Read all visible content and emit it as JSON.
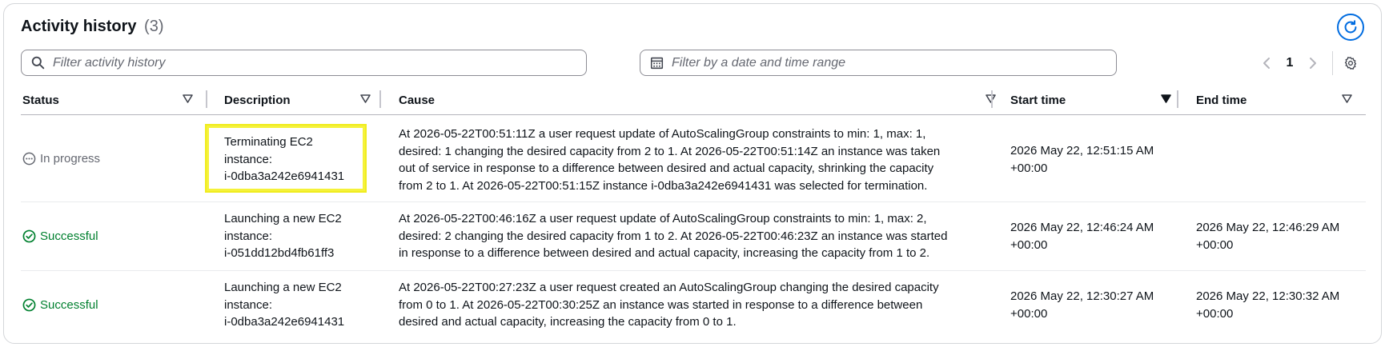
{
  "header": {
    "title": "Activity history",
    "count": "(3)"
  },
  "filters": {
    "search_placeholder": "Filter activity history",
    "date_placeholder": "Filter by a date and time range"
  },
  "pagination": {
    "current_page": "1"
  },
  "columns": {
    "status": "Status",
    "description": "Description",
    "cause": "Cause",
    "start_time": "Start time",
    "end_time": "End time"
  },
  "rows": [
    {
      "status": "In progress",
      "status_type": "in-progress",
      "description": [
        "Terminating EC2",
        "instance:",
        "i-0dba3a242e6941431"
      ],
      "cause": [
        "At 2026-05-22T00:51:11Z a user request update of AutoScalingGroup constraints to min: 1, max: 1,",
        "desired: 1 changing the desired capacity from 2 to 1. At 2026-05-22T00:51:14Z an instance was taken",
        "out of service in response to a difference between desired and actual capacity, shrinking the capacity",
        "from 2 to 1. At 2026-05-22T00:51:15Z instance i-0dba3a242e6941431 was selected for termination."
      ],
      "start_time": [
        "2026 May 22, 12:51:15 AM",
        "+00:00"
      ],
      "end_time": [
        "",
        ""
      ]
    },
    {
      "status": "Successful",
      "status_type": "success",
      "description": [
        "Launching a new EC2",
        "instance:",
        "i-051dd12bd4fb61ff3"
      ],
      "cause": [
        "At 2026-05-22T00:46:16Z a user request update of AutoScalingGroup constraints to min: 1, max: 2,",
        "desired: 2 changing the desired capacity from 1 to 2. At 2026-05-22T00:46:23Z an instance was started",
        "in response to a difference between desired and actual capacity, increasing the capacity from 1 to 2."
      ],
      "start_time": [
        "2026 May 22, 12:46:24 AM",
        "+00:00"
      ],
      "end_time": [
        "2026 May 22, 12:46:29 AM",
        "+00:00"
      ]
    },
    {
      "status": "Successful",
      "status_type": "success",
      "description": [
        "Launching a new EC2",
        "instance:",
        "i-0dba3a242e6941431"
      ],
      "cause": [
        "At 2026-05-22T00:27:23Z a user request created an AutoScalingGroup changing the desired capacity",
        "from 0 to 1. At 2026-05-22T00:30:25Z an instance was started in response to a difference between",
        "desired and actual capacity, increasing the capacity from 0 to 1."
      ],
      "start_time": [
        "2026 May 22, 12:30:27 AM",
        "+00:00"
      ],
      "end_time": [
        "2026 May 22, 12:30:32 AM",
        "+00:00"
      ]
    }
  ],
  "colors": {
    "accent": "#006ce0",
    "success": "#00802f",
    "muted": "#656871",
    "highlight": "#f5f23a"
  },
  "icons": [
    "refresh-icon",
    "search-icon",
    "calendar-icon",
    "chevron-left-icon",
    "chevron-right-icon",
    "gear-icon",
    "sort-caret-icon",
    "in-progress-icon",
    "success-icon"
  ]
}
